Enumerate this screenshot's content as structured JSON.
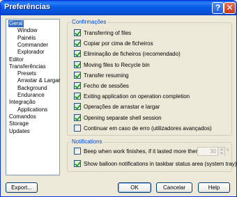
{
  "window": {
    "title": "Preferências",
    "help_label": "?",
    "close_label": "✕"
  },
  "tree": {
    "items": [
      {
        "label": "Geral",
        "indent": 0,
        "selected": true
      },
      {
        "label": "Window",
        "indent": 1,
        "selected": false
      },
      {
        "label": "Painéis",
        "indent": 1,
        "selected": false
      },
      {
        "label": "Commander",
        "indent": 1,
        "selected": false
      },
      {
        "label": "Explorador",
        "indent": 1,
        "selected": false
      },
      {
        "label": "Editor",
        "indent": 0,
        "selected": false
      },
      {
        "label": "Transferências",
        "indent": 0,
        "selected": false
      },
      {
        "label": "Presets",
        "indent": 1,
        "selected": false
      },
      {
        "label": "Arrastar & Largar",
        "indent": 1,
        "selected": false
      },
      {
        "label": "Background",
        "indent": 1,
        "selected": false
      },
      {
        "label": "Endurance",
        "indent": 1,
        "selected": false
      },
      {
        "label": "Integração",
        "indent": 0,
        "selected": false
      },
      {
        "label": "Applications",
        "indent": 1,
        "selected": false
      },
      {
        "label": "Comandos",
        "indent": 0,
        "selected": false
      },
      {
        "label": "Storage",
        "indent": 0,
        "selected": false
      },
      {
        "label": "Updates",
        "indent": 0,
        "selected": false
      }
    ]
  },
  "confirmations": {
    "label": "Confirmações",
    "options": [
      {
        "label": "Transferring of files",
        "checked": true
      },
      {
        "label": "Copiar por cima de ficheiros",
        "checked": true
      },
      {
        "label": "Eliminação de ficheiros (recomendado)",
        "checked": true
      },
      {
        "label": "Moving files to Recycle bin",
        "checked": true
      },
      {
        "label": "Transfer resuming",
        "checked": true
      },
      {
        "label": "Fecho de sessões",
        "checked": true
      },
      {
        "label": "Exiting application on operation completion",
        "checked": true
      },
      {
        "label": "Operações de arrastar e largar",
        "checked": true
      },
      {
        "label": "Opening separate shell session",
        "checked": true
      },
      {
        "label": "Continuar em caso de erro (utilizadores avançados)",
        "checked": false
      }
    ]
  },
  "notifications": {
    "label": "Notifications",
    "beep": {
      "label": "Beep when work finishes, if it lasted more then",
      "checked": false,
      "value": "30",
      "suffix": "s"
    },
    "balloon": {
      "label": "Show balloon notifications in taskbar status area (system tray)",
      "checked": true
    }
  },
  "buttons": {
    "export": "Export...",
    "ok": "OK",
    "cancel": "Cancelar",
    "help": "Help"
  }
}
